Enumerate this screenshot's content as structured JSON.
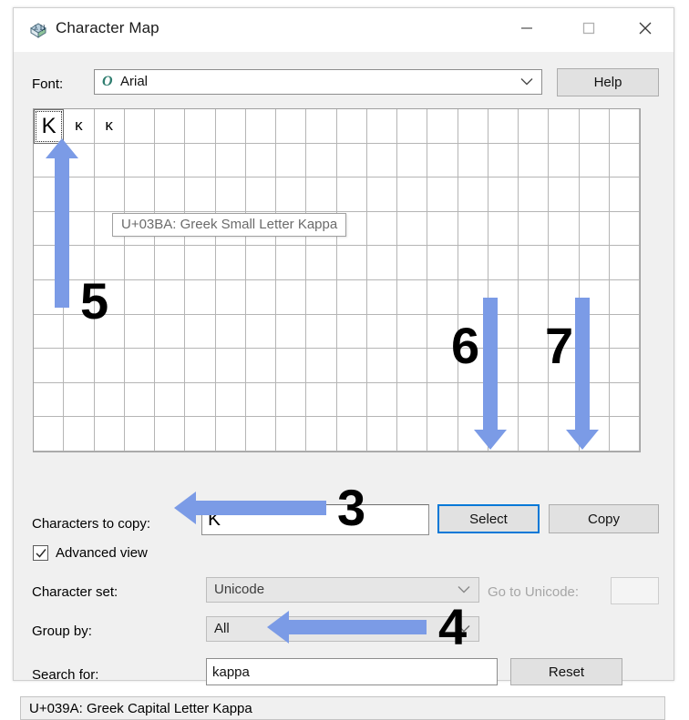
{
  "window": {
    "title": "Character Map",
    "app_icon": "character-map-icon",
    "controls": {
      "minimize": "minimize-icon",
      "maximize": "maximize-icon",
      "close": "close-icon"
    }
  },
  "font_row": {
    "label": "Font:",
    "value": "Arial",
    "type_icon": "O",
    "dropdown_icon": "chevron-down-icon",
    "help_label": "Help"
  },
  "grid": {
    "columns": 20,
    "rows": 10,
    "cells": [
      {
        "char": "Κ",
        "selected": true
      },
      {
        "char": "κ",
        "selected": false
      },
      {
        "char": "ĸ",
        "selected": false
      }
    ],
    "tooltip": "U+03BA: Greek Small Letter Kappa"
  },
  "copy_row": {
    "label": "Characters to copy:",
    "value": "Κ",
    "select_label": "Select",
    "copy_label": "Copy"
  },
  "advanced": {
    "label": "Advanced view",
    "checked": true,
    "check_icon": "checkmark-icon"
  },
  "charset_row": {
    "label": "Character set:",
    "value": "Unicode",
    "goto_label": "Go to Unicode:",
    "goto_value": ""
  },
  "group_row": {
    "label": "Group by:",
    "value": "All"
  },
  "search_row": {
    "label": "Search for:",
    "value": "kappa",
    "reset_label": "Reset"
  },
  "status": {
    "text": "U+039A: Greek Capital Letter Kappa"
  },
  "annotations": {
    "arrow_color": "#7B9BE6",
    "items": [
      {
        "number": "3",
        "points_to": "advanced-view-checkbox",
        "direction": "left"
      },
      {
        "number": "4",
        "points_to": "search-input",
        "direction": "left"
      },
      {
        "number": "5",
        "points_to": "grid-cell-selected",
        "direction": "up"
      },
      {
        "number": "6",
        "points_to": "select-button",
        "direction": "down"
      },
      {
        "number": "7",
        "points_to": "copy-button",
        "direction": "down"
      }
    ]
  }
}
